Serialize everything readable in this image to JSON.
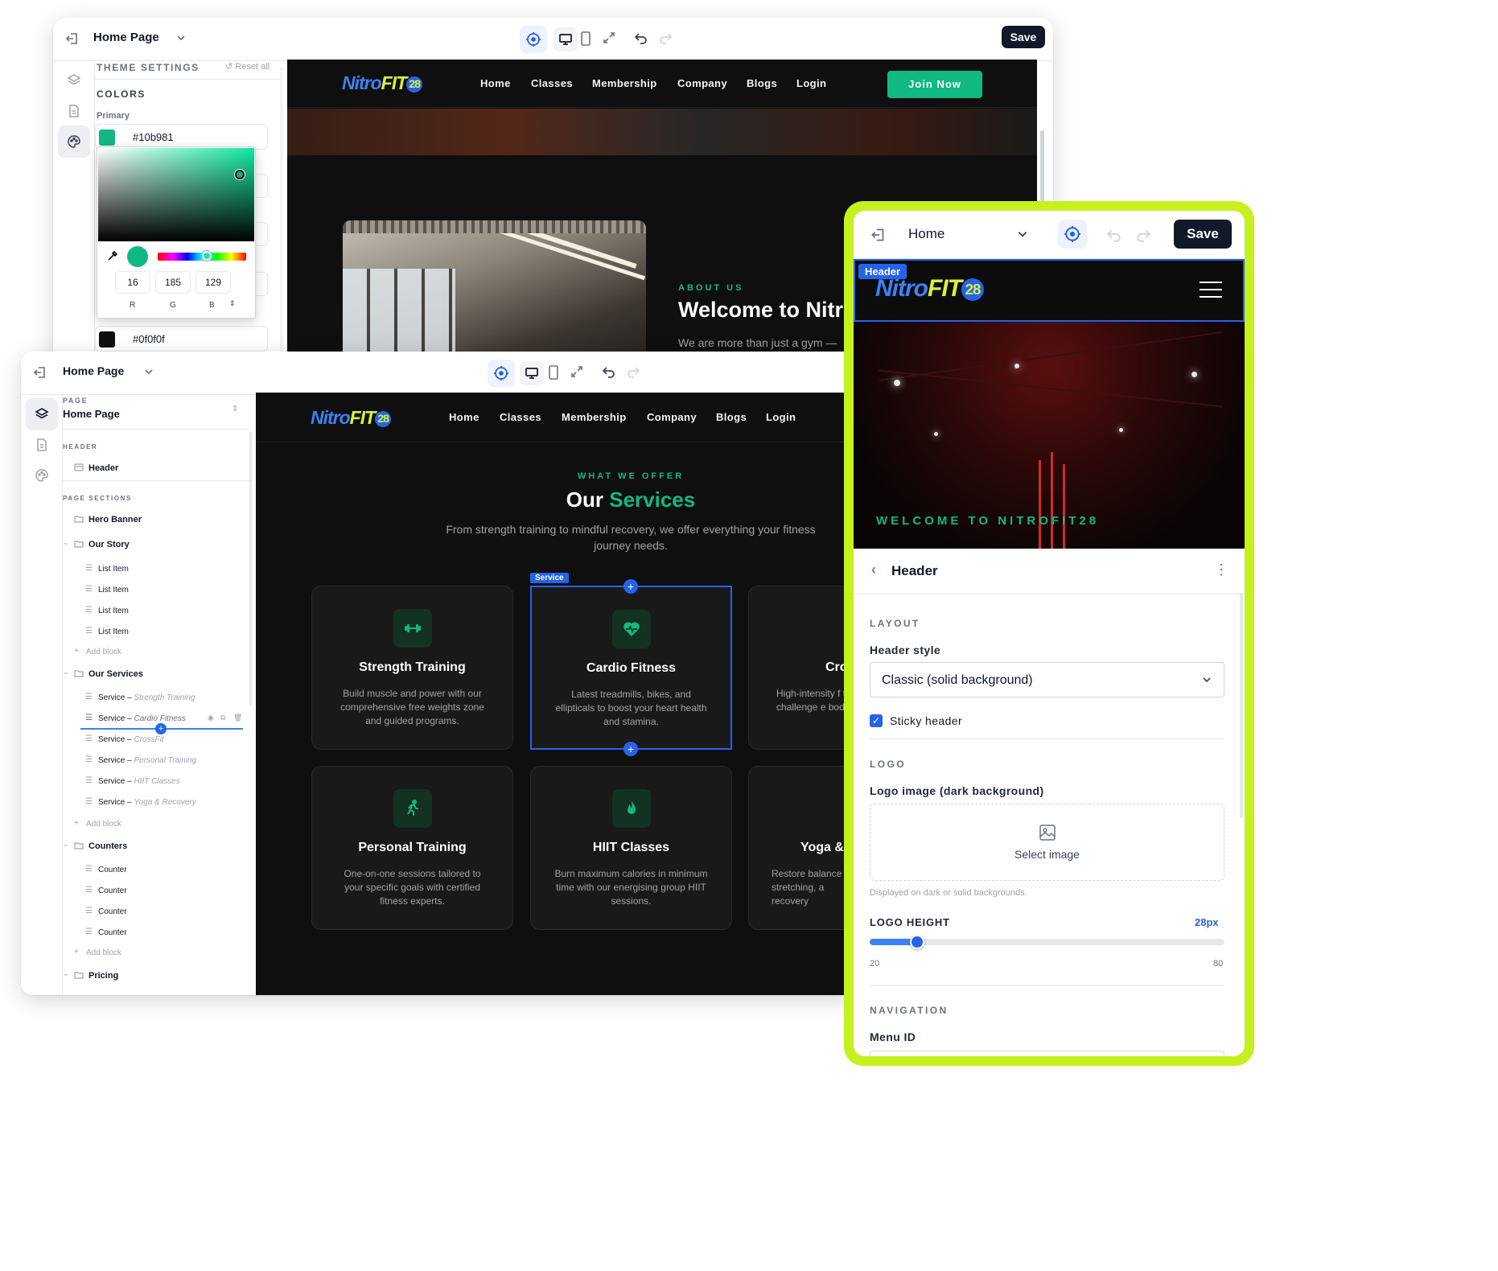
{
  "win1": {
    "page_select": "Home Page",
    "save": "Save",
    "sidebar": {
      "title": "THEME SETTINGS",
      "reset": "Reset all",
      "colors_heading": "COLORS",
      "primary_label": "Primary",
      "primary_value": "#10b981",
      "picker": {
        "r": "16",
        "g": "185",
        "b": "129",
        "r_label": "R",
        "g_label": "G",
        "b_label": "B"
      },
      "dark_value": "#0f0f0f"
    },
    "site": {
      "nav": [
        "Home",
        "Classes",
        "Membership",
        "Company",
        "Blogs",
        "Login"
      ],
      "join": "Join Now",
      "about_kicker": "ABOUT US",
      "about_title": "Welcome to Nitro",
      "about_text": "We are more than just a gym —"
    }
  },
  "win2": {
    "page_select": "Home Page",
    "tree": {
      "page_caption": "PAGE",
      "page_name": "Home Page",
      "header_caption": "HEADER",
      "header_item": "Header",
      "sections_caption": "PAGE SECTIONS",
      "hero": "Hero Banner",
      "our_story": "Our Story",
      "list_items": [
        "List Item",
        "List Item",
        "List Item",
        "List Item"
      ],
      "add_block": "Add block",
      "our_services": "Our Services",
      "services": [
        {
          "prefix": "Service – ",
          "name": "Strength Training"
        },
        {
          "prefix": "Service – ",
          "name": "Cardio Fitness"
        },
        {
          "prefix": "Service – ",
          "name": "CrossFit"
        },
        {
          "prefix": "Service – ",
          "name": "Personal Training"
        },
        {
          "prefix": "Service – ",
          "name": "HIIT Classes"
        },
        {
          "prefix": "Service – ",
          "name": "Yoga & Recovery"
        }
      ],
      "counters": "Counters",
      "counter_items": [
        "Counter",
        "Counter",
        "Counter",
        "Counter"
      ],
      "pricing": "Pricing"
    },
    "site": {
      "nav": [
        "Home",
        "Classes",
        "Membership",
        "Company",
        "Blogs",
        "Login"
      ],
      "kicker": "WHAT WE OFFER",
      "title_a": "Our ",
      "title_b": "Services",
      "intro": "From strength training to mindful recovery, we offer everything your fitness journey needs.",
      "selection_tag": "Service",
      "cards": [
        {
          "title": "Strength Training",
          "desc": "Build muscle and power with our comprehensive free weights zone and guided programs."
        },
        {
          "title": "Cardio Fitness",
          "desc": "Latest treadmills, bikes, and ellipticals to boost your heart health and stamina."
        },
        {
          "title": "Cro",
          "desc": "High-intensity f to challenge e body a"
        },
        {
          "title": "Personal Training",
          "desc": "One-on-one sessions tailored to your specific goals with certified fitness experts."
        },
        {
          "title": "HIIT Classes",
          "desc": "Burn maximum calories in minimum time with our energising group HIIT sessions."
        },
        {
          "title": "Yoga &",
          "desc": "Restore balance stretching, a recovery"
        }
      ]
    }
  },
  "win3": {
    "page_select": "Home",
    "save": "Save",
    "preview": {
      "tag": "Header",
      "welcome": "WELCOME TO NITROFIT28"
    },
    "logo": {
      "main": "Nitro",
      "fit": "FIT",
      "num": "28"
    },
    "panel": {
      "title": "Header",
      "layout_caption": "LAYOUT",
      "style_label": "Header style",
      "style_value": "Classic (solid background)",
      "sticky_label": "Sticky header",
      "sticky_checked": true,
      "logo_caption": "LOGO",
      "logo_label": "Logo image (dark background)",
      "select_image": "Select image",
      "logo_hint": "Displayed on dark or solid backgrounds.",
      "height_label": "LOGO HEIGHT",
      "height_value": "28px",
      "height_min": "20",
      "height_max": "80",
      "height_fraction": 0.133,
      "nav_caption": "NAVIGATION",
      "menu_label": "Menu ID"
    }
  },
  "colors": {
    "primary": "#10b981",
    "dark": "#0f0f0f",
    "accent_lime": "#c6f01e",
    "selection_blue": "#2563eb"
  }
}
